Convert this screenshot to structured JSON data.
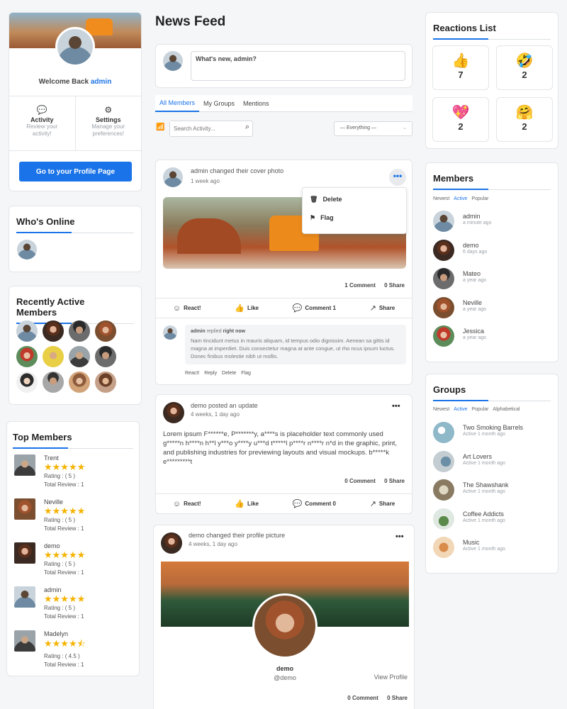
{
  "profile_card": {
    "welcome_prefix": "Welcome Back",
    "username": "admin",
    "activity_title": "Activity",
    "activity_desc": "Review your activity!",
    "settings_title": "Settings",
    "settings_desc": "Manage your preferences!",
    "profile_button": "Go to your Profile Page"
  },
  "whos_online": {
    "title": "Who's Online"
  },
  "recent_members": {
    "title": "Recently Active Members"
  },
  "top_members": {
    "title": "Top Members",
    "items": [
      {
        "name": "Trent",
        "rating_text": "Rating : ( 5 )",
        "total_text": "Total Review : 1",
        "stars": 5
      },
      {
        "name": "Neville",
        "rating_text": "Rating : ( 5 )",
        "total_text": "Total Review : 1",
        "stars": 5
      },
      {
        "name": "demo",
        "rating_text": "Rating : ( 5 )",
        "total_text": "Total Review : 1",
        "stars": 5
      },
      {
        "name": "admin",
        "rating_text": "Rating : ( 5 )",
        "total_text": "Total Review : 1",
        "stars": 5
      },
      {
        "name": "Madelyn",
        "rating_text": "Rating : ( 4.5 )",
        "total_text": "Total Review : 1",
        "stars": 4.5
      }
    ]
  },
  "feed": {
    "title": "News Feed",
    "post_placeholder": "What's new, admin?",
    "tabs": [
      "All Members",
      "My Groups",
      "Mentions"
    ],
    "search_placeholder": "Search Activity...",
    "filter_value": "— Everything —",
    "post1": {
      "author": "admin",
      "action": "changed their cover photo",
      "time": "1 week ago",
      "menu_delete": "Delete",
      "menu_flag": "Flag",
      "comment_count": "1 Comment",
      "share_count": "0 Share",
      "react_label": "React!",
      "like_label": "Like",
      "comment_label": "Comment 1",
      "share_label": "Share",
      "reply_author": "admin",
      "reply_verb": "replied",
      "reply_time": "right now",
      "reply_text": "Nam tincidunt metus in mauris aliquam, id tempus odio dignissim. Aenean sa gittis id magna at imperdiet. Duis consectetur magna at ante congue, ut rho ncus ipsum luctus. Donec finibus molestie nibh ut mollis.",
      "reply_actions": [
        "React!",
        "Reply",
        "Delete",
        "Flag"
      ]
    },
    "post2": {
      "author": "demo",
      "action": "posted an update",
      "time": "4 weeks, 1 day ago",
      "text": "Lorem ipsum F******e, P*******y, a****s is placeholder text commonly used g*****n h****n h**l y***o y****y u***d t*****l p****r n****r n*d in the graphic, print, and publishing industries for previewing layouts and visual mockups. b*****k e*********t",
      "comment_count": "0 Comment",
      "share_count": "0 Share",
      "react_label": "React!",
      "like_label": "Like",
      "comment_label": "Comment 0",
      "share_label": "Share"
    },
    "post3": {
      "author": "demo",
      "action": "changed their profile picture",
      "time": "4 weeks, 1 day ago",
      "profile_name": "demo",
      "profile_handle": "@demo",
      "view_profile": "View Profile",
      "comment_count": "0 Comment",
      "share_count": "0 Share"
    }
  },
  "reactions": {
    "title": "Reactions List",
    "items": [
      {
        "emoji": "👍",
        "count": "7"
      },
      {
        "emoji": "🤣",
        "count": "2"
      },
      {
        "emoji": "💖",
        "count": "2"
      },
      {
        "emoji": "🤗",
        "count": "2"
      }
    ]
  },
  "members": {
    "title": "Members",
    "sort": [
      "Newest",
      "Active",
      "Popular"
    ],
    "items": [
      {
        "name": "admin",
        "time": "a minute ago"
      },
      {
        "name": "demo",
        "time": "6 days ago"
      },
      {
        "name": "Mateo",
        "time": "a year ago"
      },
      {
        "name": "Neville",
        "time": "a year ago"
      },
      {
        "name": "Jessica",
        "time": "a year ago"
      }
    ]
  },
  "groups": {
    "title": "Groups",
    "sort": [
      "Newest",
      "Active",
      "Popular",
      "Alphabetical"
    ],
    "items": [
      {
        "name": "Two Smoking Barrels",
        "time": "Active 1 month ago"
      },
      {
        "name": "Art Lovers",
        "time": "Active 1 month ago"
      },
      {
        "name": "The Shawshank",
        "time": "Active 1 month ago"
      },
      {
        "name": "Coffee Addicts",
        "time": "Active 1 month ago"
      },
      {
        "name": "Music",
        "time": "Active 1 month ago"
      }
    ]
  },
  "colors": {
    "accent": "#1a73e8",
    "star": "#f5b301"
  }
}
